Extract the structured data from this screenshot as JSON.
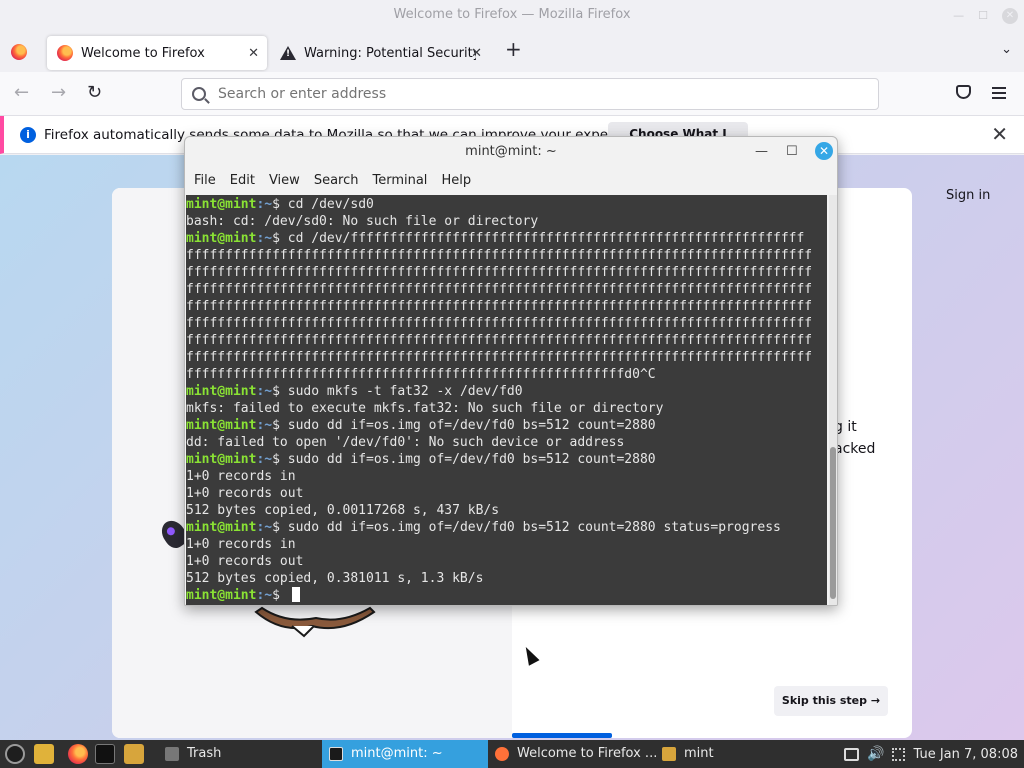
{
  "firefox": {
    "window_title": "Welcome to Firefox — Mozilla Firefox",
    "tabs": [
      {
        "label": "Welcome to Firefox",
        "close": "✕"
      },
      {
        "label": "Warning: Potential Security",
        "close": "✕"
      }
    ],
    "new_tab": "+",
    "list_tabs": "⌄",
    "back": "←",
    "forward": "→",
    "reload": "↻",
    "url_placeholder": "Search or enter address",
    "notification": {
      "text": "Firefox automatically sends some data to Mozilla so that we can improve your experience.",
      "button": "Choose What I Share",
      "close": "✕"
    },
    "sign_in": "Sign in",
    "onboarding_text_line1": "g it",
    "onboarding_text_line2": "acked",
    "skip_button": "Skip this step →"
  },
  "terminal": {
    "title": "mint@mint: ~",
    "minimize": "—",
    "maximize": "☐",
    "close": "✕",
    "menu": [
      "File",
      "Edit",
      "View",
      "Search",
      "Terminal",
      "Help"
    ],
    "prompt_user": "mint@mint",
    "prompt_path": ":~",
    "prompt_symbol": "$ ",
    "lines": [
      {
        "type": "cmd",
        "text": "cd /dev/sd0"
      },
      {
        "type": "out",
        "text": "bash: cd: /dev/sd0: No such file or directory"
      },
      {
        "type": "cmd",
        "text": "cd /dev/ffffffffffffffffffffffffffffffffffffffffffffffffffffffffff"
      },
      {
        "type": "out",
        "text": "ffffffffffffffffffffffffffffffffffffffffffffffffffffffffffffffffffffffffffffffff"
      },
      {
        "type": "out",
        "text": "ffffffffffffffffffffffffffffffffffffffffffffffffffffffffffffffffffffffffffffffff"
      },
      {
        "type": "out",
        "text": "ffffffffffffffffffffffffffffffffffffffffffffffffffffffffffffffffffffffffffffffff"
      },
      {
        "type": "out",
        "text": "ffffffffffffffffffffffffffffffffffffffffffffffffffffffffffffffffffffffffffffffff"
      },
      {
        "type": "out",
        "text": "ffffffffffffffffffffffffffffffffffffffffffffffffffffffffffffffffffffffffffffffff"
      },
      {
        "type": "out",
        "text": "ffffffffffffffffffffffffffffffffffffffffffffffffffffffffffffffffffffffffffffffff"
      },
      {
        "type": "out",
        "text": "ffffffffffffffffffffffffffffffffffffffffffffffffffffffffffffffffffffffffffffffff"
      },
      {
        "type": "out",
        "text": "ffffffffffffffffffffffffffffffffffffffffffffffffffffffffd0^C"
      },
      {
        "type": "cmd",
        "text": "sudo mkfs -t fat32 -x /dev/fd0"
      },
      {
        "type": "out",
        "text": "mkfs: failed to execute mkfs.fat32: No such file or directory"
      },
      {
        "type": "cmd",
        "text": "sudo dd if=os.img of=/dev/fd0 bs=512 count=2880"
      },
      {
        "type": "out",
        "text": "dd: failed to open '/dev/fd0': No such device or address"
      },
      {
        "type": "cmd",
        "text": "sudo dd if=os.img of=/dev/fd0 bs=512 count=2880"
      },
      {
        "type": "out",
        "text": "1+0 records in"
      },
      {
        "type": "out",
        "text": "1+0 records out"
      },
      {
        "type": "out",
        "text": "512 bytes copied, 0.00117268 s, 437 kB/s"
      },
      {
        "type": "cmd",
        "text": "sudo dd if=os.img of=/dev/fd0 bs=512 count=2880 status=progress"
      },
      {
        "type": "out",
        "text": "1+0 records in"
      },
      {
        "type": "out",
        "text": "1+0 records out"
      },
      {
        "type": "out",
        "text": "512 bytes copied, 0.381011 s, 1.3 kB/s"
      },
      {
        "type": "cmd",
        "text": "",
        "cursor": true
      }
    ]
  },
  "taskbar": {
    "tasks": [
      {
        "label": "Trash"
      },
      {
        "label": "mint@mint: ~"
      },
      {
        "label": "Welcome to Firefox ..."
      },
      {
        "label": "mint"
      }
    ],
    "clock": "Tue Jan  7, 08:08"
  },
  "colors": {
    "prompt_green": "#8ae234",
    "prompt_blue": "#729fcf",
    "terminal_bg": "#3b3b3b",
    "taskbar_active": "#35a0de",
    "firefox_accent": "#0060df"
  }
}
